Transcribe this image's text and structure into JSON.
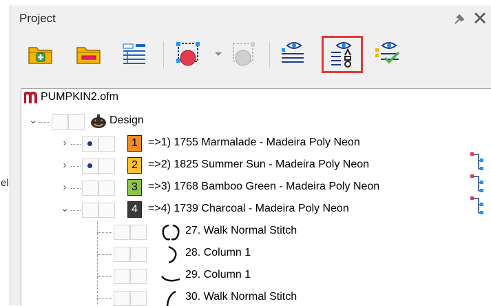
{
  "left_edge_text": "el",
  "panel": {
    "title": "Project"
  },
  "toolbar": {
    "items": [
      {
        "name": "add-folder-button",
        "icon": "folder-plus-icon"
      },
      {
        "name": "remove-folder-button",
        "icon": "folder-minus-icon"
      },
      {
        "name": "layout-button",
        "icon": "tree-layout-icon"
      },
      {
        "name": "select-object-button",
        "icon": "select-object-icon"
      },
      {
        "name": "dropdown-arrow",
        "icon": "dropdown-icon"
      },
      {
        "name": "disabled-object-button",
        "icon": "disabled-object-icon"
      },
      {
        "name": "list-visibility-button",
        "icon": "list-eye-icon"
      },
      {
        "name": "properties-visibility-button",
        "icon": "properties-eye-icon",
        "selected": true
      },
      {
        "name": "check-visibility-button",
        "icon": "check-eye-icon"
      }
    ]
  },
  "tree": {
    "file": "PUMPKIN2.ofm",
    "design": "Design",
    "colors": [
      {
        "num": "1",
        "label": "=>1) 1755 Marmalade - Madeira Poly Neon",
        "swatch": "#f28c28",
        "text_color": "#000000",
        "eye": true
      },
      {
        "num": "2",
        "label": "=>2) 1825 Summer Sun - Madeira Poly Neon",
        "swatch": "#fbc02d",
        "text_color": "#000000",
        "eye": true
      },
      {
        "num": "3",
        "label": "=>3) 1768 Bamboo Green - Madeira Poly Neon",
        "swatch": "#8bc34a",
        "text_color": "#000000",
        "eye": false
      },
      {
        "num": "4",
        "label": "=>4) 1739 Charcoal - Madeira Poly Neon",
        "swatch": "#3a3a3a",
        "text_color": "#ffffff",
        "eye": false
      }
    ],
    "objects": [
      {
        "label": "27. Walk Normal Stitch",
        "icon": "loop-stitch-icon"
      },
      {
        "label": "28. Column 1",
        "icon": "column-arc-icon"
      },
      {
        "label": "29. Column 1",
        "icon": "column-curve-icon"
      },
      {
        "label": "30. Walk Normal Stitch",
        "icon": "walk-arc-icon"
      }
    ]
  },
  "colors": {
    "accent_red": "#e53935",
    "logo_red": "#c0162c"
  }
}
